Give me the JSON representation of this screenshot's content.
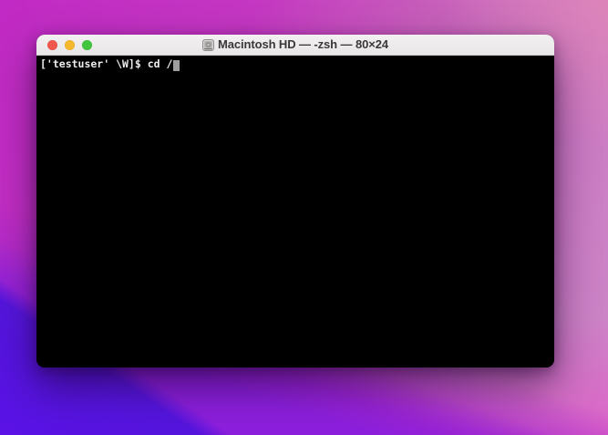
{
  "window": {
    "title": "Macintosh HD — -zsh — 80×24",
    "title_icon": "hard-drive-icon",
    "titlebar_bg": "#efeded",
    "controls": {
      "close_color": "#f2574e",
      "minimize_color": "#f5b82d",
      "zoom_color": "#42c53e"
    }
  },
  "terminal": {
    "prompt_line": "['testuser' \\W]$ cd /",
    "cursor_style": "block",
    "background": "#000000",
    "text_color": "#ededed",
    "cursor_color": "#9e9e9e"
  },
  "wallpaper": {
    "magenta": "#c12ac4",
    "light_pink": "#cd89c8",
    "bright_pink": "#e44fc8",
    "purple": "#8c1fdc",
    "violet": "#5a12e6"
  }
}
